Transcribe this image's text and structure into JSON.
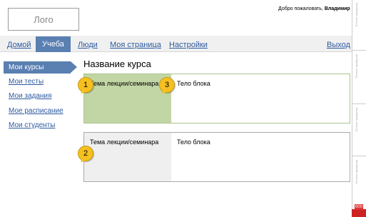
{
  "header": {
    "logo": "Лого",
    "welcome_prefix": "Добро пожаловать, ",
    "welcome_user": "Владимир"
  },
  "nav": {
    "items": [
      "Домой",
      "Учеба",
      "Люди",
      "Моя страница",
      "Настройки"
    ],
    "active_index": 1,
    "logout": "Выход"
  },
  "sidebar": {
    "items": [
      "Мои курсы",
      "Мои тесты",
      "Мои задания",
      "Мое расписание",
      "Мои студенты"
    ],
    "active_index": 0
  },
  "main": {
    "title": "Название курса",
    "blocks": [
      {
        "topic": "Тема лекции/семинара",
        "body": "Тело блока"
      },
      {
        "topic": "Тема лекции/семинара",
        "body": "Тело блока"
      }
    ]
  },
  "markers": [
    "1",
    "3",
    "2"
  ],
  "strip": {
    "labels": [
      "Полное прокрутки",
      "Полное прокрутки",
      "Полное прокрутки",
      "Полное прокрутки"
    ],
    "bottom_value": "600"
  },
  "colors": {
    "accent": "#5a7fb1",
    "link": "#2d5aa0",
    "topic_active": "#c1d6a4",
    "topic_inactive": "#efefef",
    "marker": "#f5c020"
  }
}
